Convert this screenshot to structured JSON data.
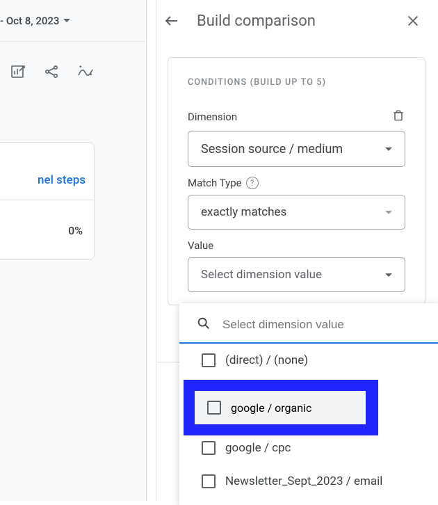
{
  "date_range": {
    "text": "- Oct 8, 2023"
  },
  "panel": {
    "title": "Build comparison"
  },
  "conditions": {
    "header": "Conditions (build up to 5)",
    "dimension_label": "Dimension",
    "dimension_value": "Session source / medium",
    "match_label": "Match Type",
    "match_value": "exactly matches",
    "value_label": "Value",
    "value_placeholder": "Select dimension value"
  },
  "left_card": {
    "top_text": "nel steps",
    "bottom_text": "0%"
  },
  "dropdown": {
    "search_placeholder": "Select dimension value",
    "options": [
      "(direct) / (none)",
      "google / organic",
      "google / cpc",
      "Newsletter_Sept_2023 / email"
    ]
  }
}
